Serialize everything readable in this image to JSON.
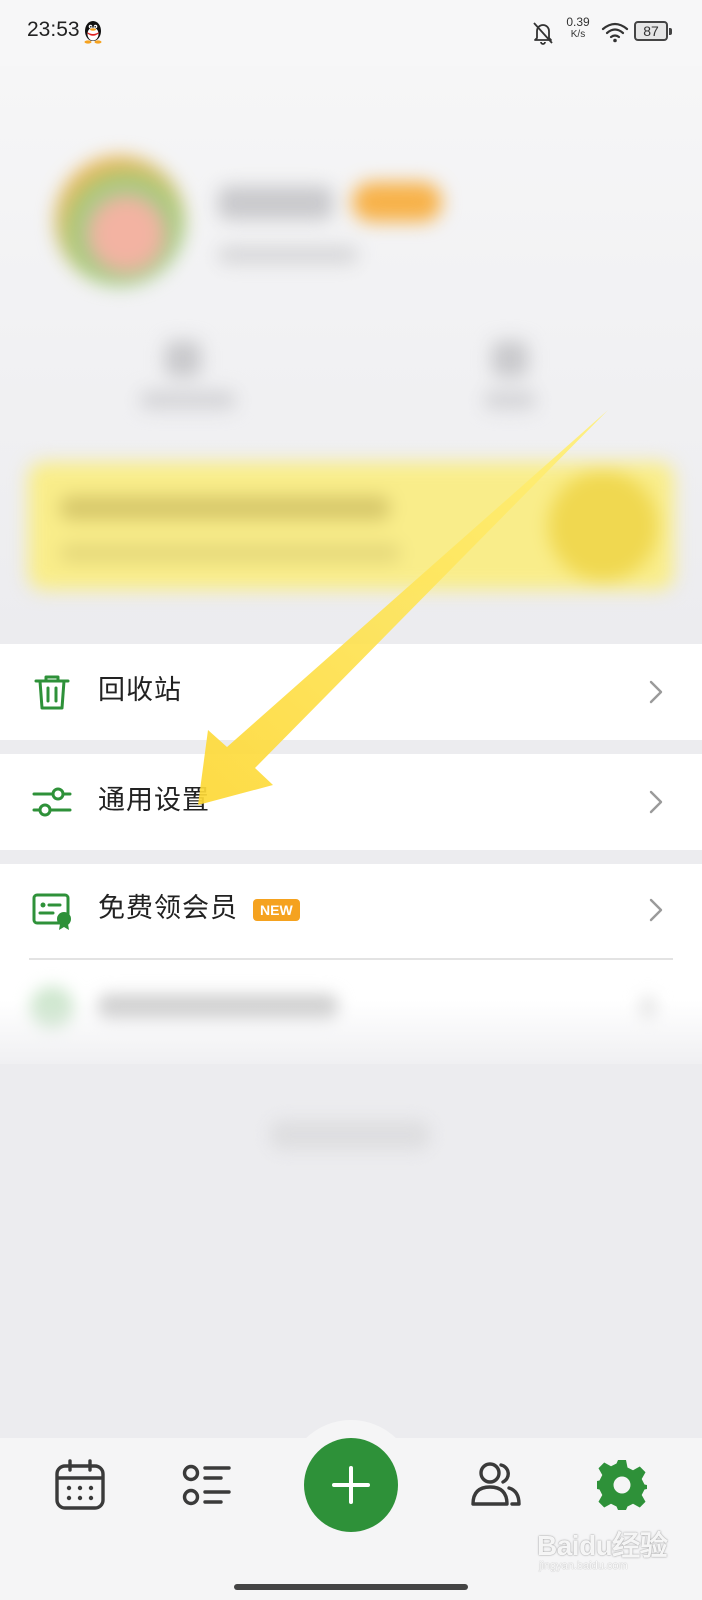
{
  "status_bar": {
    "time": "23:53",
    "net_speed_value": "0.39",
    "net_speed_unit": "K/s",
    "battery": "87",
    "icons": [
      "qq-icon",
      "bell-muted-icon",
      "wifi-icon",
      "battery-icon"
    ]
  },
  "menu": {
    "items": [
      {
        "label": "回收站",
        "icon": "trash-icon"
      },
      {
        "label": "通用设置",
        "icon": "sliders-icon"
      },
      {
        "label": "免费领会员",
        "icon": "member-card-icon",
        "badge": "NEW"
      }
    ]
  },
  "bottom_nav": {
    "items": [
      "calendar-icon",
      "list-icon",
      "plus-icon",
      "contacts-icon",
      "settings-gear-icon"
    ],
    "active": "settings-gear-icon"
  },
  "watermark": {
    "logo": "Baidu经验",
    "url": "jingyan.baidu.com"
  },
  "colors": {
    "accent_green": "#2e9139",
    "badge_orange": "#f5a21f",
    "annotation_arrow": "#fde05a"
  }
}
